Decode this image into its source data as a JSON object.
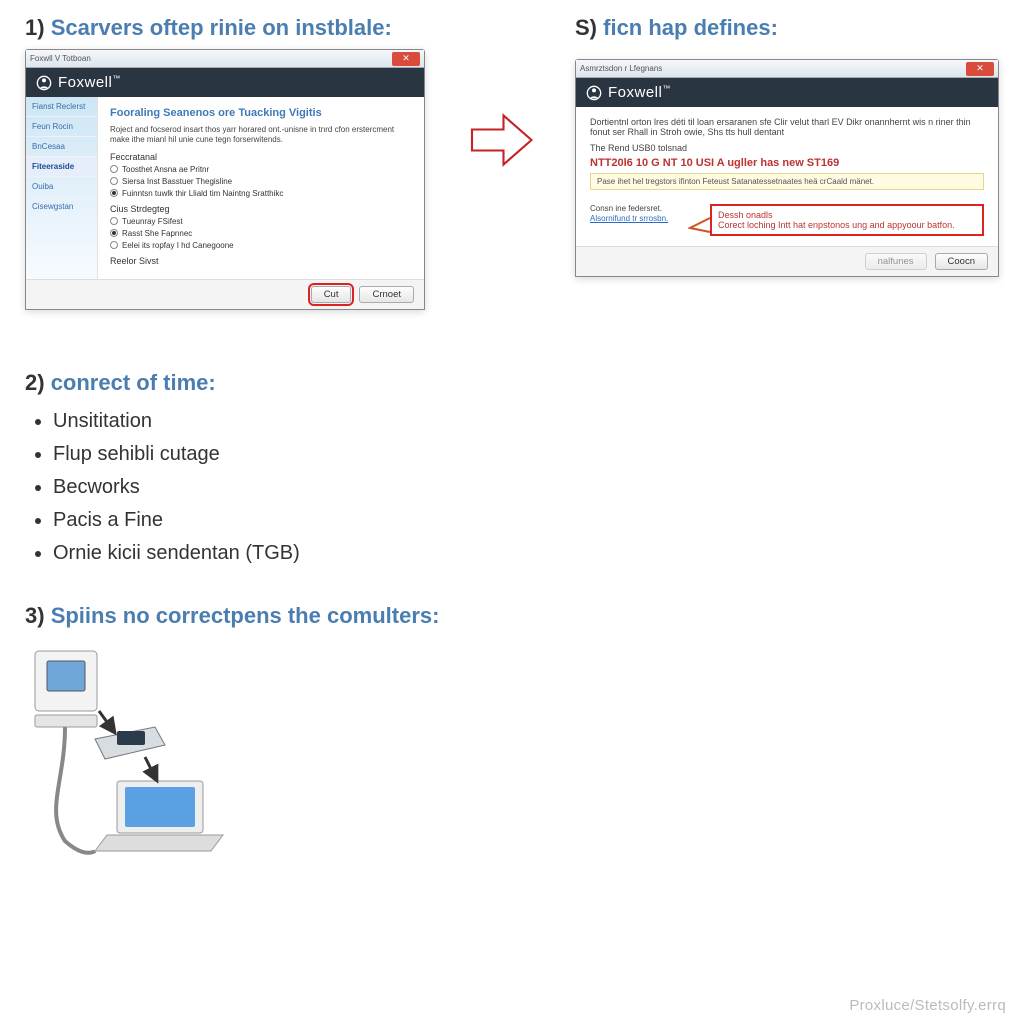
{
  "step1": {
    "num": "1)",
    "title": "Scarvers oftep rinie on instblale:"
  },
  "stepS": {
    "num": "S)",
    "title": "ficn hap defines:"
  },
  "window1": {
    "title": "Foxwll V Totboan",
    "brand": "Foxwell",
    "sidebar": [
      "Fianst Reclerst",
      "Feun Rocin",
      "BnCesaa",
      "Fiteeraside",
      "Ouiba",
      "Cisewgstan"
    ],
    "sidebar_active_index": 3,
    "heading": "Fooraling Seanenos ore Tuacking Vigitis",
    "intro": "Roject and focserod insart thos yarr horared ont.-unisne in tnrd cfon erstercment make ithe mianl hil unie cune tegn forserwitends.",
    "group1_label": "Feccratanal",
    "group1_opts": [
      "Toosthet Ansna ae Pritnr",
      "Siersa Inst Basstuer Thegisline",
      "Fuinntsn tuwlk thir Lliald tim Naintng Sratthikc"
    ],
    "group2_label": "Cius Strdegteg",
    "group2_opts": [
      "Tueunray FSifest",
      "Rasst She Fapnnec",
      "Eelei its ropfay I hd Canegoone"
    ],
    "footer_label": "Reelor Sivst",
    "btn_ok": "Cut",
    "btn_cancel": "Crnoet"
  },
  "window2": {
    "title": "Asmrztsdon r Lfegnans",
    "brand": "Foxwell",
    "line1": "Dortientnl orton lres déti til loan ersaranen sfe Clir velut tharl EV Dikr onannhernt wis n riner thin fonut ser Rhall in Stroh owie, Shs tts hull dentant",
    "sub_heading": "The Rend USB0 tolsnad",
    "notice": "NTT20l6 10 G NT 10 USI A ugller has new ST169",
    "warnbar": "Pase ihet hel tregstors ifinton Feteust Satanatessetnaates heä crCaald mänet.",
    "callout_t1": "Dessh onadls",
    "callout_t2": "Corect loching Intt hat enpstonos ung and appyoour batfon.",
    "addl_label": "Consn ine federsret.",
    "addl_link": "Alsornifund tr srrosbn.",
    "btn_a": "nalfunes",
    "btn_b": "Coocn"
  },
  "step2": {
    "num": "2)",
    "title": "conrect of time:"
  },
  "bullets": [
    "Unsititation",
    "Flup sehibli cutage",
    "Becworks",
    "Pacis a Fine",
    "Ornie kicii sendentan (TGB)"
  ],
  "step3": {
    "num": "3)",
    "title": "Spiins no correctpens the comulters:"
  },
  "watermark": "Proxluce/Stetsolfy.errq"
}
